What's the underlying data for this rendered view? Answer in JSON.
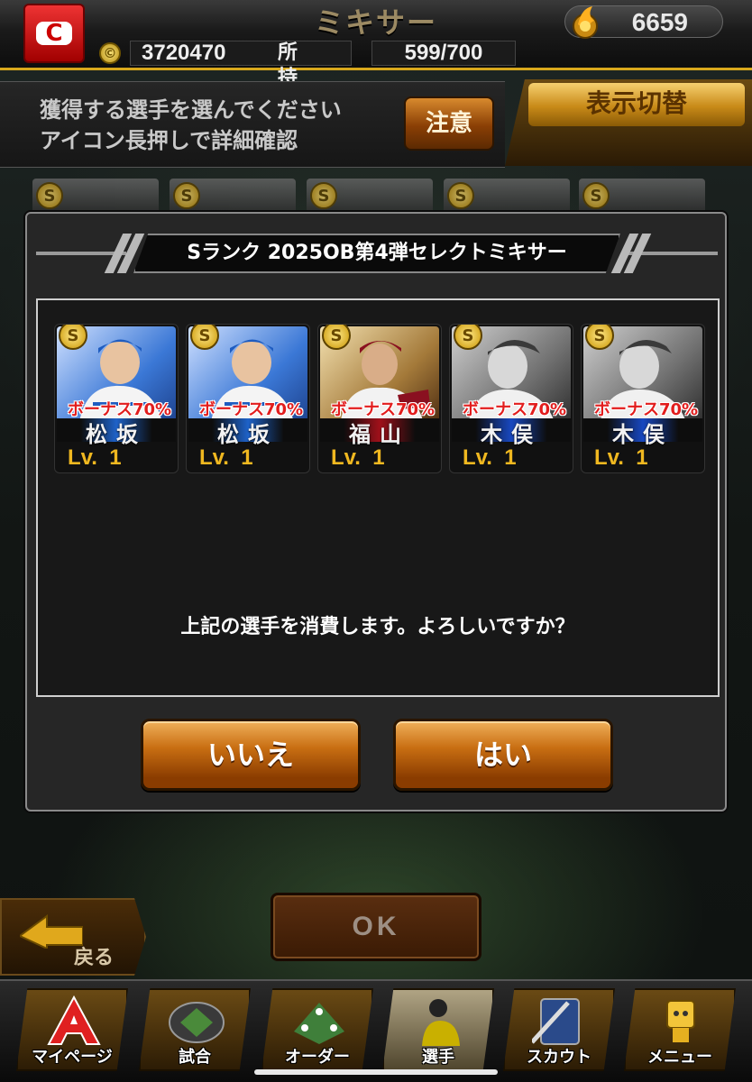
{
  "header": {
    "title": "ミキサー",
    "team_logo": "C",
    "points": "6659",
    "coin_value": "3720470",
    "owned_label": "所持選手",
    "owned_value": "599/700"
  },
  "instruction": {
    "text": "獲得する選手を選んでください\nアイコン長押しで詳細確認",
    "note_button": "注意",
    "toggle_button": "表示切替"
  },
  "dialog": {
    "title": "Sランク 2025OB第4弾セレクトミキサー",
    "cards": [
      {
        "rank": "S",
        "bonus": "ボーナス70%",
        "name": "松坂",
        "level": "Lv.  1",
        "team_color": "#1e62c8"
      },
      {
        "rank": "S",
        "bonus": "ボーナス70%",
        "name": "松坂",
        "level": "Lv.  1",
        "team_color": "#1e62c8"
      },
      {
        "rank": "S",
        "bonus": "ボーナス70%",
        "name": "福山",
        "level": "Lv.  1",
        "team_color": "#a0101a"
      },
      {
        "rank": "S",
        "bonus": "ボーナス70%",
        "name": "木俣",
        "level": "Lv.  1",
        "team_color": "#1848c0"
      },
      {
        "rank": "S",
        "bonus": "ボーナス70%",
        "name": "木俣",
        "level": "Lv.  1",
        "team_color": "#1848c0"
      }
    ],
    "confirm_text": "上記の選手を消費します。よろしいですか？",
    "no_button": "いいえ",
    "yes_button": "はい"
  },
  "bottom": {
    "back_label": "戻る",
    "ok_label": "OK"
  },
  "nav": [
    {
      "label": "マイページ",
      "icon": "mypage-icon"
    },
    {
      "label": "試合",
      "icon": "stadium-icon"
    },
    {
      "label": "オーダー",
      "icon": "order-icon"
    },
    {
      "label": "選手",
      "icon": "player-icon"
    },
    {
      "label": "スカウト",
      "icon": "scout-icon"
    },
    {
      "label": "メニュー",
      "icon": "menu-icon"
    }
  ],
  "colors": {
    "accent_gold": "#d8a81c",
    "button_orange": "#c86e12",
    "level_yellow": "#f0b820",
    "bonus_red": "#e21d1d"
  }
}
